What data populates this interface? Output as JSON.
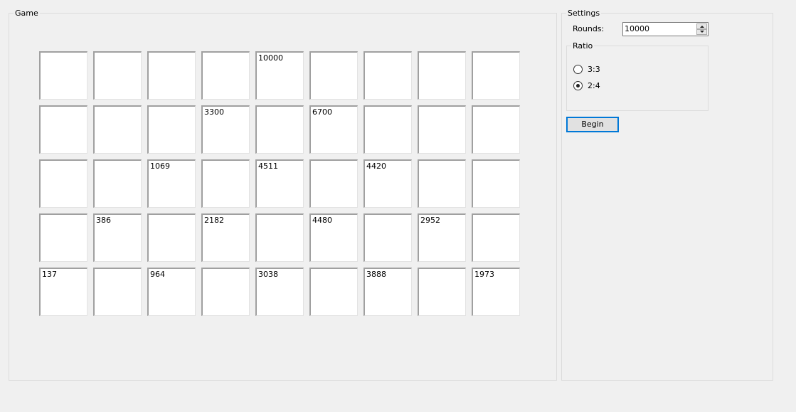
{
  "game": {
    "title": "Game",
    "grid": {
      "rows": 5,
      "cols": 9,
      "cells": [
        "",
        "",
        "",
        "",
        "10000",
        "",
        "",
        "",
        "",
        "",
        "",
        "",
        "3300",
        "",
        "6700",
        "",
        "",
        "",
        "",
        "",
        "1069",
        "",
        "4511",
        "",
        "4420",
        "",
        "",
        "",
        "386",
        "",
        "2182",
        "",
        "4480",
        "",
        "2952",
        "",
        "137",
        "",
        "964",
        "",
        "3038",
        "",
        "3888",
        "",
        "1973"
      ]
    }
  },
  "settings": {
    "title": "Settings",
    "rounds_label": "Rounds:",
    "rounds_value": "10000",
    "ratio": {
      "title": "Ratio",
      "options": [
        {
          "label": "3:3",
          "checked": false
        },
        {
          "label": "2:4",
          "checked": true
        }
      ]
    },
    "begin_label": "Begin"
  }
}
